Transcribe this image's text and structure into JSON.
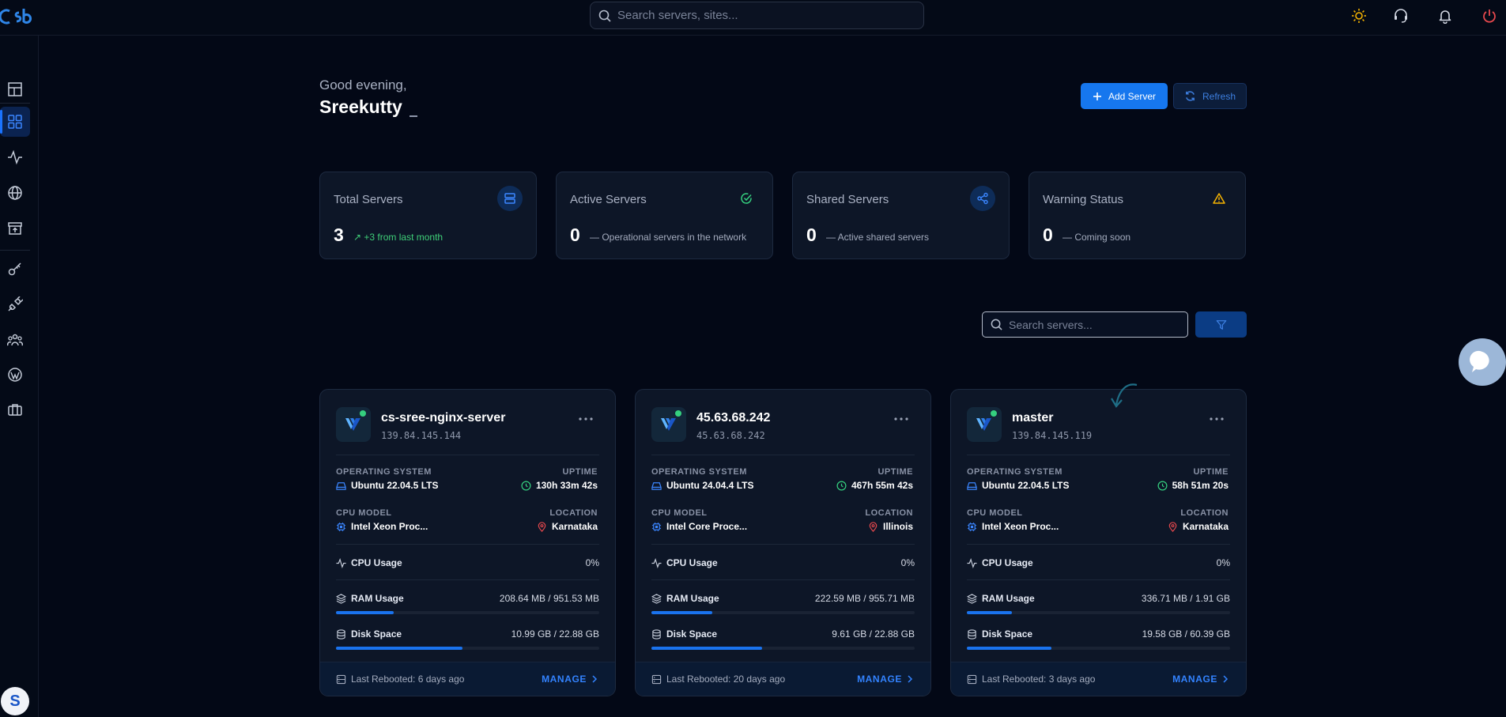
{
  "search": {
    "placeholder": "Search servers, sites..."
  },
  "greeting": {
    "text": "Good evening,",
    "name": "Sreekutty"
  },
  "actions": {
    "add_label": "Add Server",
    "refresh_label": "Refresh"
  },
  "stats": [
    {
      "title": "Total Servers",
      "value": "3",
      "note": "+3 from last month",
      "icon": "server-stack-icon"
    },
    {
      "title": "Active Servers",
      "value": "0",
      "note": "— Operational servers in the network",
      "icon": "check-circle-icon"
    },
    {
      "title": "Shared Servers",
      "value": "0",
      "note": "— Active shared servers",
      "icon": "share-icon"
    },
    {
      "title": "Warning Status",
      "value": "0",
      "note": "— Coming soon",
      "icon": "warning-icon"
    }
  ],
  "server_search": {
    "placeholder": "Search servers..."
  },
  "labels": {
    "os": "OPERATING SYSTEM",
    "uptime": "UPTIME",
    "cpu_model": "CPU MODEL",
    "location": "LOCATION",
    "cpu_usage": "CPU Usage",
    "ram_usage": "RAM Usage",
    "disk_space": "Disk Space",
    "manage": "MANAGE"
  },
  "servers": [
    {
      "name": "cs-sree-nginx-server",
      "ip": "139.84.145.144",
      "os": "Ubuntu 22.04.5 LTS",
      "uptime": "130h 33m 42s",
      "cpu_model": "Intel Xeon Proc...",
      "location": "Karnataka",
      "cpu_usage": "0%",
      "ram": "208.64 MB / 951.53 MB",
      "ram_fraction": 0.22,
      "disk": "10.99 GB / 22.88 GB",
      "disk_fraction": 0.48,
      "rebooted": "Last Rebooted: 6 days ago"
    },
    {
      "name": "45.63.68.242",
      "ip": "45.63.68.242",
      "os": "Ubuntu 24.04.4 LTS",
      "uptime": "467h 55m 42s",
      "cpu_model": "Intel Core Proce...",
      "location": "Illinois",
      "cpu_usage": "0%",
      "ram": "222.59 MB / 955.71 MB",
      "ram_fraction": 0.23,
      "disk": "9.61 GB / 22.88 GB",
      "disk_fraction": 0.42,
      "rebooted": "Last Rebooted: 20 days ago"
    },
    {
      "name": "master",
      "ip": "139.84.145.119",
      "os": "Ubuntu 22.04.5 LTS",
      "uptime": "58h 51m 20s",
      "cpu_model": "Intel Xeon Proc...",
      "location": "Karnataka",
      "cpu_usage": "0%",
      "ram": "336.71 MB / 1.91 GB",
      "ram_fraction": 0.17,
      "disk": "19.58 GB / 60.39 GB",
      "disk_fraction": 0.32,
      "rebooted": "Last Rebooted: 3 days ago"
    }
  ],
  "user": {
    "initial": "S"
  },
  "colors": {
    "accent": "#1677ee",
    "success": "#35d07f",
    "warning": "#f5b301",
    "danger": "#e5484d"
  }
}
